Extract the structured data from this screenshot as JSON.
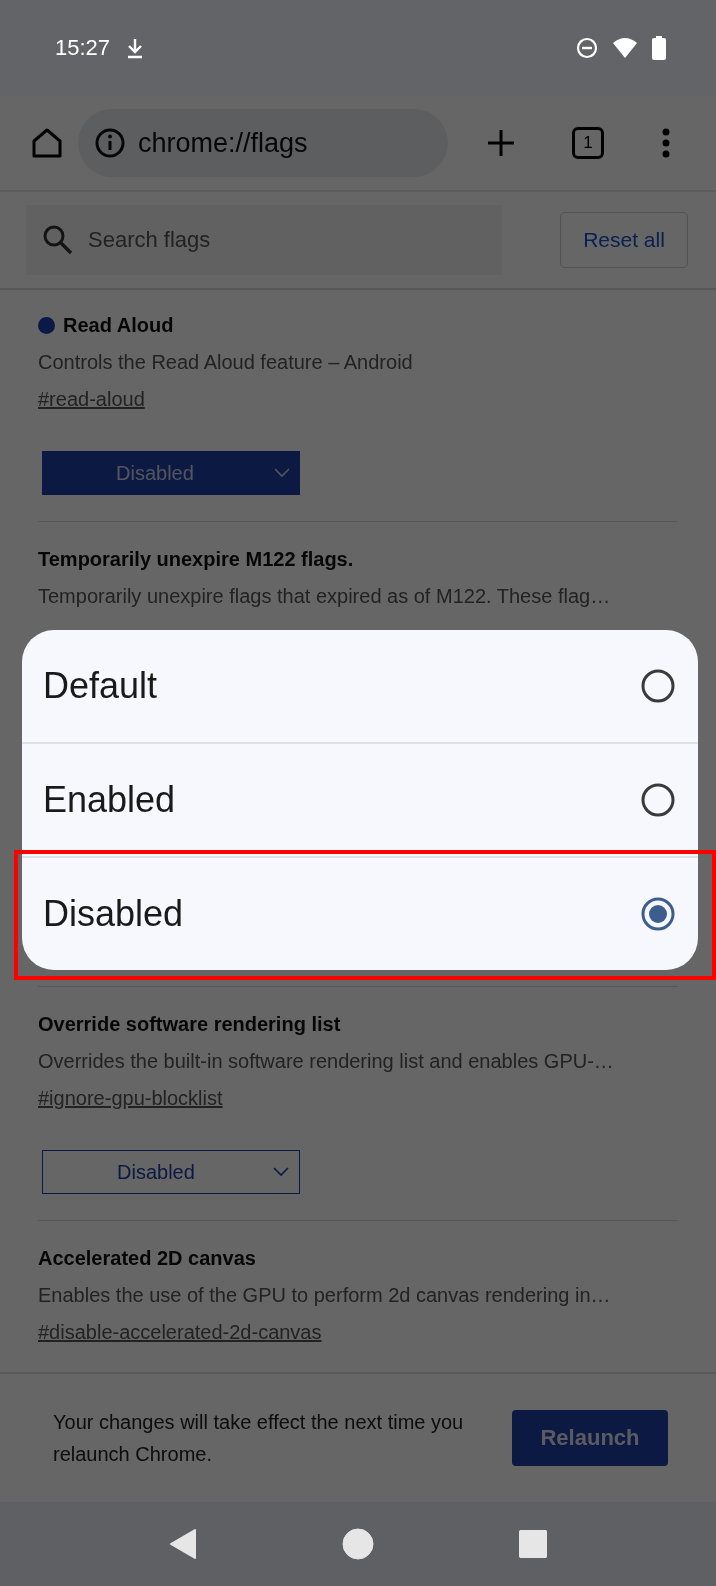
{
  "status_bar": {
    "time": "15:27"
  },
  "toolbar": {
    "url": "chrome://flags",
    "tab_count": "1"
  },
  "search": {
    "placeholder": "Search flags"
  },
  "reset_button": "Reset all",
  "flags": [
    {
      "title": "Read Aloud",
      "modified": true,
      "description": "Controls the Read Aloud feature – Android",
      "hashtag": "#read-aloud",
      "select": "Disabled",
      "covered_below": false
    },
    {
      "title": "Temporarily unexpire M122 flags.",
      "modified": false,
      "description": "Temporarily unexpire flags that expired as of M122. These flag…",
      "covered_below": true
    },
    {
      "title": "Override software rendering list",
      "modified": false,
      "description": "Overrides the built-in software rendering list and enables GPU-…",
      "hashtag": "#ignore-gpu-blocklist",
      "select": "Disabled",
      "covered_below": false
    },
    {
      "title": "Accelerated 2D canvas",
      "modified": false,
      "description": "Enables the use of the GPU to perform 2d canvas rendering in…",
      "hashtag": "#disable-accelerated-2d-canvas",
      "covered_below": false
    }
  ],
  "footer": {
    "message": "Your changes will take effect the next time you relaunch Chrome.",
    "button": "Relaunch"
  },
  "dialog": {
    "options": [
      {
        "label": "Default",
        "selected": false,
        "highlighted": false
      },
      {
        "label": "Enabled",
        "selected": false,
        "highlighted": false
      },
      {
        "label": "Disabled",
        "selected": true,
        "highlighted": true
      }
    ]
  }
}
